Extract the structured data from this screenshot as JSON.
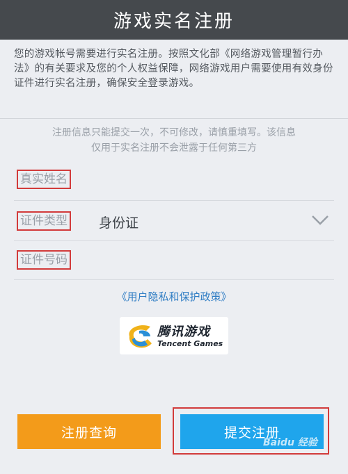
{
  "header": {
    "title": "游戏实名注册"
  },
  "intro": {
    "text": "您的游戏帐号需要进行实名注册。按照文化部《网络游戏管理暂行办法》的有关要求及您的个人权益保障，网络游戏用户需要使用有效身份证件进行实名注册，确保安全登录游戏。"
  },
  "notice": {
    "line1": "注册信息只能提交一次，不可修改，请慎重填写。该信息",
    "line2": "仅用于实名注册不会泄露于任何第三方"
  },
  "form": {
    "real_name_label": "真实姓名",
    "id_type_label": "证件类型",
    "id_type_value": "身份证",
    "id_number_label": "证件号码"
  },
  "policy_link": "《用户隐私和保护政策》",
  "logo": {
    "cn": "腾讯游戏",
    "en": "Tencent Games"
  },
  "buttons": {
    "query": "注册查询",
    "submit": "提交注册"
  },
  "watermark": "Baidu 经验",
  "colors": {
    "header_bg": "#45494d",
    "query_btn": "#f39b1a",
    "submit_btn": "#1fa5ec",
    "link": "#2f7dc4",
    "highlight_box": "#d23b3b"
  }
}
